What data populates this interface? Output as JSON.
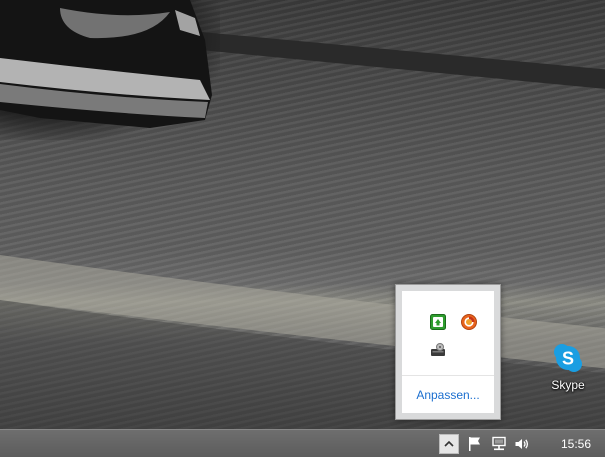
{
  "tray_popup": {
    "icons": [
      {
        "name": "green-sync-app-icon",
        "color": "#2e9d2e"
      },
      {
        "name": "orange-circle-app-icon",
        "color": "#e8641c"
      },
      {
        "name": "drive-app-icon",
        "color": "#3a3a3a"
      }
    ],
    "customize_label": "Anpassen..."
  },
  "desktop": {
    "icons": [
      {
        "label": "Skype",
        "icon": "skype-icon",
        "color": "#1a9ee2"
      }
    ]
  },
  "taskbar": {
    "show_hidden_icon": "chevron-up-icon",
    "tray_icons": [
      "action-center-flag-icon",
      "network-icon",
      "volume-icon"
    ],
    "clock": "15:56"
  }
}
